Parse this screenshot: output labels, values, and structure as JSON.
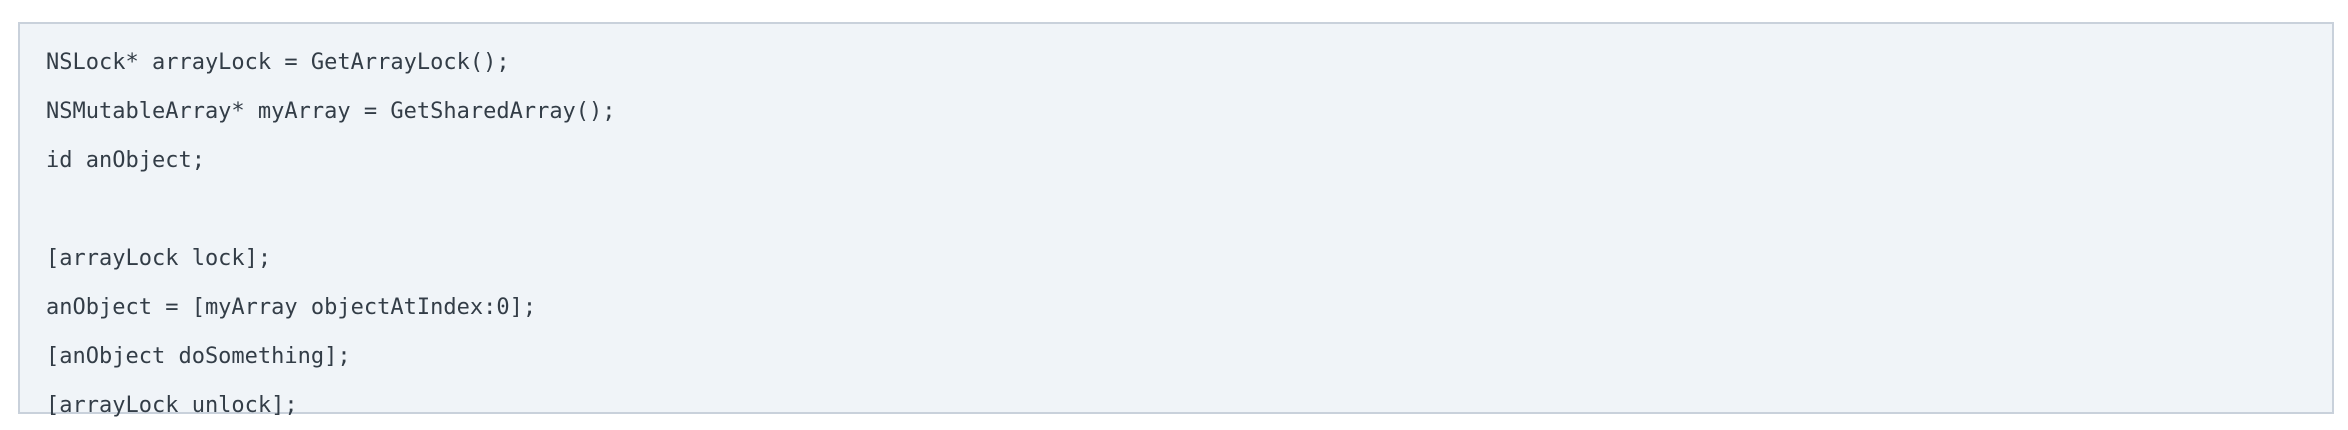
{
  "code_block": {
    "lines": [
      "NSLock* arrayLock = GetArrayLock();",
      "NSMutableArray* myArray = GetSharedArray();",
      "id anObject;",
      "",
      "[arrayLock lock];",
      "anObject = [myArray objectAtIndex:0];",
      "[anObject doSomething];",
      "[arrayLock unlock];"
    ],
    "background_color": "#f0f4f8",
    "border_color": "#c9d1db",
    "text_color": "#333d47"
  }
}
